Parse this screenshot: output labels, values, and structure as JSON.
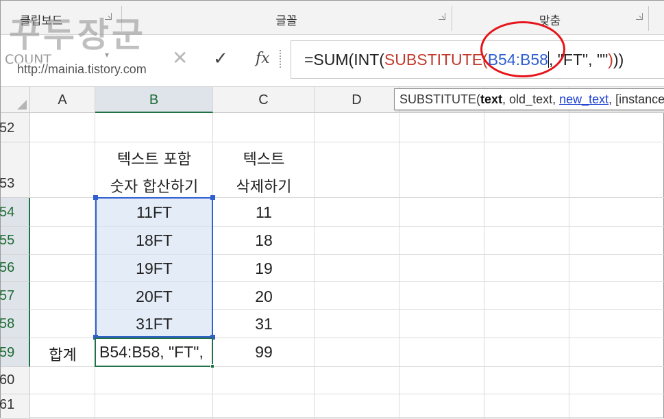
{
  "ribbon": {
    "groups": [
      {
        "label": "클립보드"
      },
      {
        "label": "글꼴"
      },
      {
        "label": "맞춤"
      }
    ]
  },
  "formula_bar": {
    "name_box": "COUNT",
    "cancel_icon": "close-icon",
    "enter_icon": "check-icon",
    "fx_label": "fx",
    "formula_parts": {
      "p1": "=SUM(INT(",
      "p2": "SUBSTITUTE(",
      "p3": "B54:B58",
      "p4": ", \"FT\", \"\"",
      "p5": ")",
      "p6": "))"
    }
  },
  "watermark": {
    "title": "꾸두장군",
    "url": "http://mainia.tistory.com"
  },
  "tooltip": {
    "fn": "SUBSTITUTE(",
    "arg1": "text",
    "sep1": ", old_text, ",
    "arg3": "new_text",
    "rest": ", [instance_num])"
  },
  "columns": [
    "A",
    "B",
    "C",
    "D"
  ],
  "rows": [
    "52",
    "53",
    "54",
    "55",
    "56",
    "57",
    "58",
    "59",
    "60",
    "61"
  ],
  "cells": {
    "B53_line1": "텍스트 포함",
    "B53_line2": "숫자 합산하기",
    "C53_line1": "텍스트",
    "C53_line2": "삭제하기",
    "B54": "11FT",
    "B55": "18FT",
    "B56": "19FT",
    "B57": "20FT",
    "B58": "31FT",
    "C54": "11",
    "C55": "18",
    "C56": "19",
    "C57": "20",
    "C58": "31",
    "A59": "합계",
    "B59": "B54:B58, \"FT\",",
    "C59": "99"
  },
  "colors": {
    "range_highlight": "#2f5fd0",
    "active_cell": "#217346",
    "annotation_circle": "#e5141a",
    "function_text": "#c0392b"
  }
}
